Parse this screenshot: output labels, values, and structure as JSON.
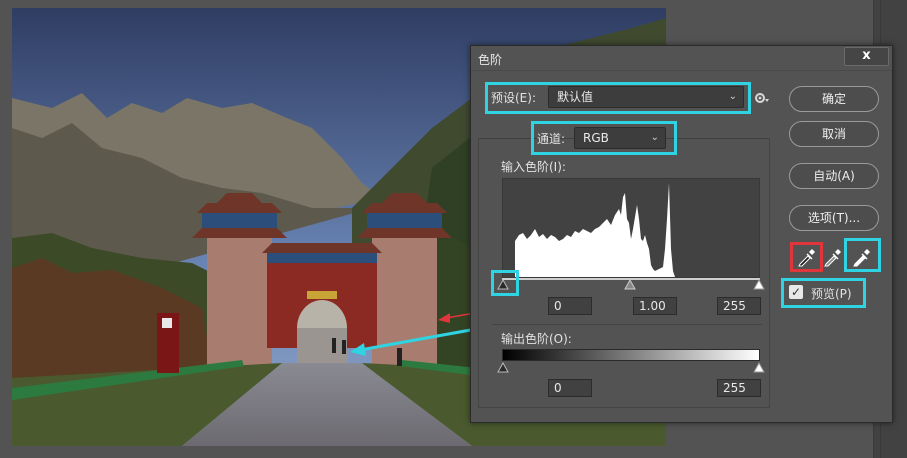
{
  "dialog": {
    "title": "色阶",
    "close_label": "x",
    "preset_label": "预设(E):",
    "preset_value": "默认值",
    "channel_label": "通道:",
    "channel_value": "RGB",
    "input_levels_label": "输入色阶(I):",
    "input_black": "0",
    "input_gamma": "1.00",
    "input_white": "255",
    "output_levels_label": "输出色阶(O):",
    "output_black": "0",
    "output_white": "255",
    "buttons": {
      "ok": "确定",
      "cancel": "取消",
      "auto": "自动(A)",
      "options": "选项(T)..."
    },
    "preview_label": "预览(P)",
    "preview_checked": true
  },
  "icons": {
    "gear": "gear-icon",
    "close": "close-icon",
    "chevron": "chevron-down-icon",
    "black_eyedropper": "black-eyedropper-icon",
    "gray_eyedropper": "gray-eyedropper-icon",
    "white_eyedropper": "white-eyedropper-icon"
  },
  "colors": {
    "highlight_cyan": "#2fd3e1",
    "highlight_red": "#e0353a",
    "dialog_bg": "#535353"
  }
}
